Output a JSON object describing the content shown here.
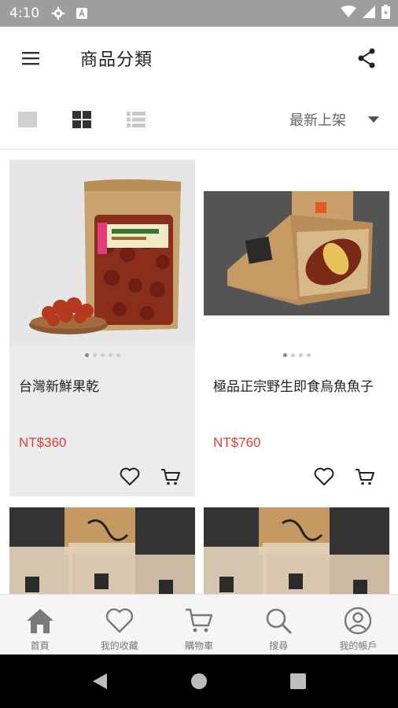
{
  "status_bar": {
    "time": "4:10"
  },
  "app_bar": {
    "title": "商品分類"
  },
  "view_toolbar": {
    "sort_label": "最新上架"
  },
  "products": [
    {
      "name": "台灣新鮮果乾",
      "price": "NT$360"
    },
    {
      "name": "極品正宗野生即食烏魚魚子",
      "price": "NT$760"
    }
  ],
  "bottom_nav": [
    {
      "label": "首頁",
      "icon": "home-icon"
    },
    {
      "label": "我的收藏",
      "icon": "heart-icon"
    },
    {
      "label": "購物車",
      "icon": "cart-icon"
    },
    {
      "label": "搜尋",
      "icon": "search-icon"
    },
    {
      "label": "我的帳戶",
      "icon": "account-icon"
    }
  ],
  "colors": {
    "price": "#e53935",
    "status_bar": "#9e9e9e"
  }
}
